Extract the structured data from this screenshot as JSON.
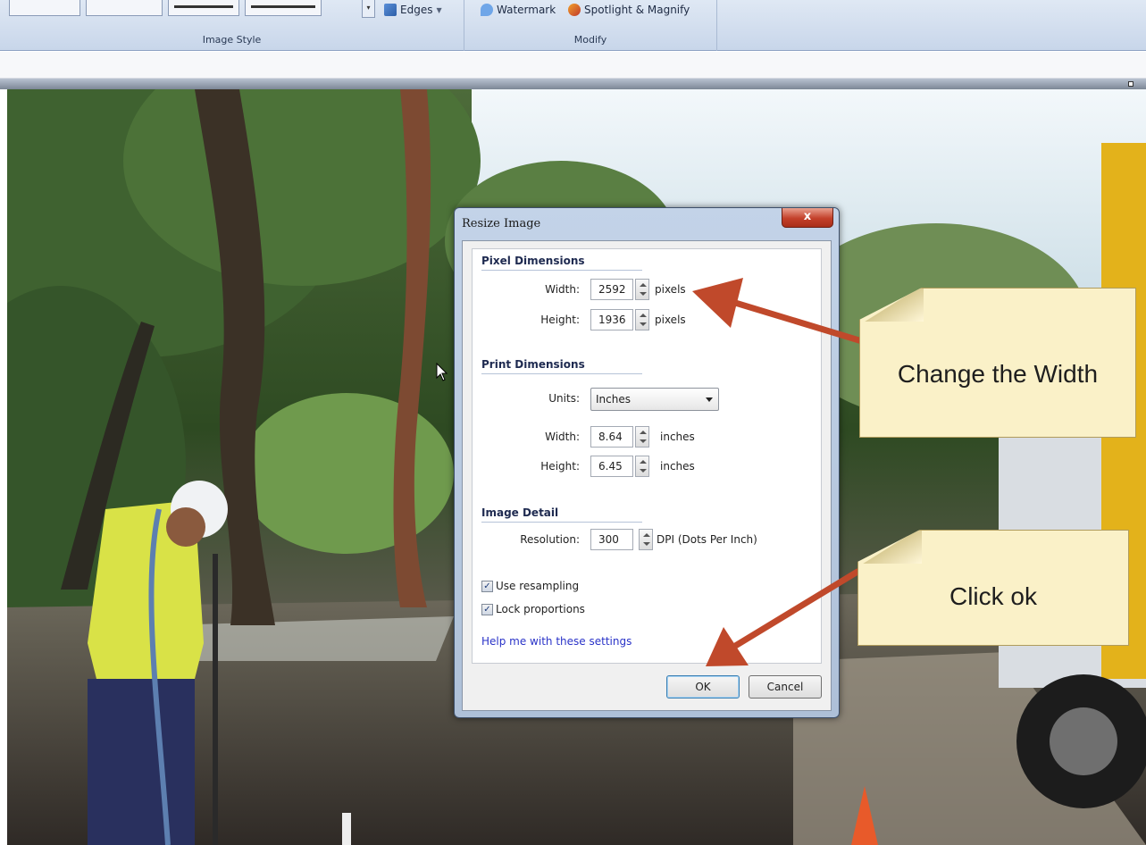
{
  "ribbon": {
    "groups": [
      {
        "label": "Image Style"
      },
      {
        "label": "Modify"
      }
    ],
    "buttons": {
      "edges": "Edges",
      "watermark": "Watermark",
      "spotlight": "Spotlight & Magnify"
    }
  },
  "dialog": {
    "title": "Resize Image",
    "close_glyph": "x",
    "pixel_dimensions": {
      "heading": "Pixel Dimensions",
      "width_label": "Width:",
      "width_value": "2592",
      "width_unit": "pixels",
      "height_label": "Height:",
      "height_value": "1936",
      "height_unit": "pixels"
    },
    "print_dimensions": {
      "heading": "Print Dimensions",
      "units_label": "Units:",
      "units_value": "Inches",
      "width_label": "Width:",
      "width_value": "8.64",
      "width_unit": "inches",
      "height_label": "Height:",
      "height_value": "6.45",
      "height_unit": "inches"
    },
    "image_detail": {
      "heading": "Image Detail",
      "resolution_label": "Resolution:",
      "resolution_value": "300",
      "resolution_unit": "DPI (Dots Per Inch)"
    },
    "checkboxes": {
      "use_resampling": {
        "label": "Use resampling",
        "checked": true
      },
      "lock_proportions": {
        "label": "Lock proportions",
        "checked": true
      }
    },
    "help_link": "Help me with these settings",
    "ok_label": "OK",
    "cancel_label": "Cancel"
  },
  "callouts": {
    "change_width": "Change the Width",
    "click_ok": "Click ok"
  },
  "colors": {
    "arrow": "#c0492b",
    "callout_fill": "#faf1c8",
    "close_button": "#c3402a"
  },
  "icons": [
    "edges-icon",
    "watermark-icon",
    "spotlight-icon",
    "close-icon",
    "spinner-icon",
    "dropdown-caret-icon",
    "checkbox-icon",
    "mouse-cursor-icon"
  ]
}
